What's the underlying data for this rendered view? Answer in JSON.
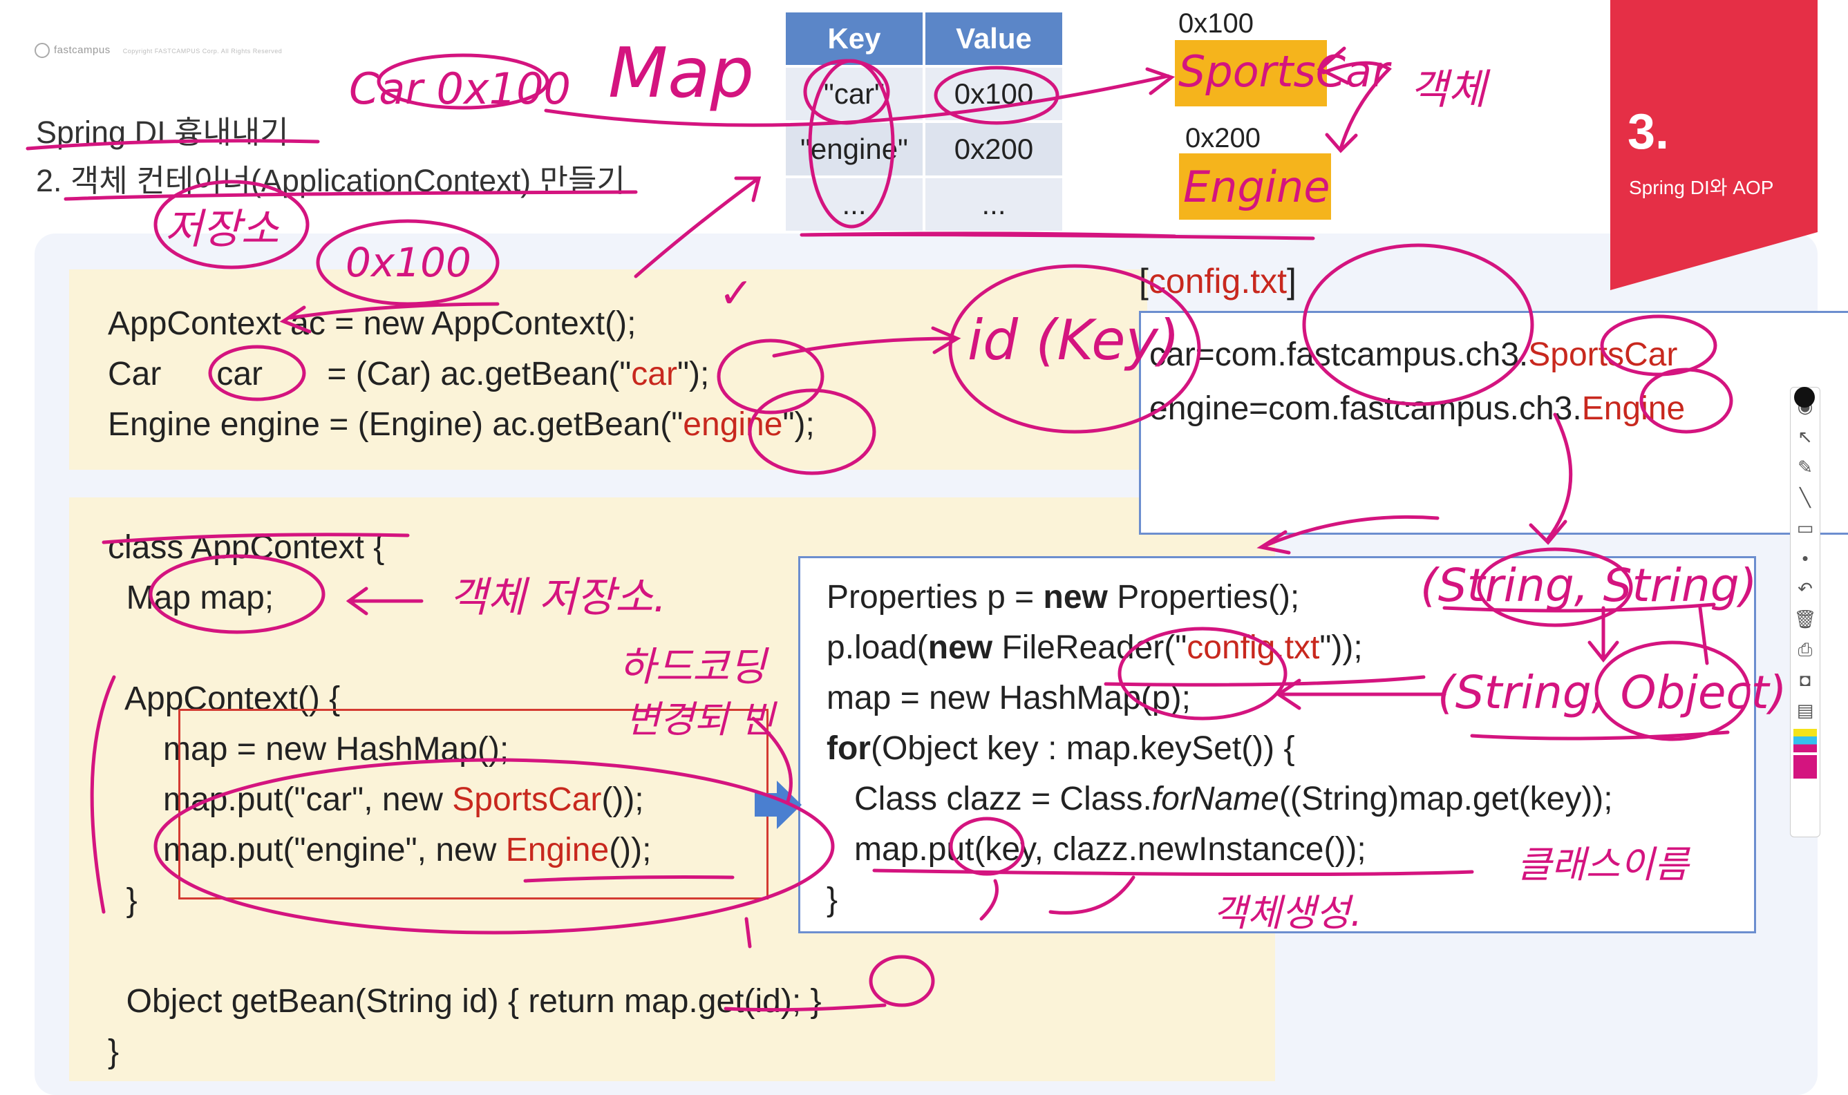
{
  "header": {
    "brand": "fastcampus",
    "copyright": "Copyright FASTCAMPUS Corp. All Rights Reserved",
    "title": "Spring DI 흉내내기",
    "subtitle": "2. 객체 컨테이너(ApplicationContext) 만들기"
  },
  "chapter": {
    "number": "3.",
    "name": "Spring DI와 AOP"
  },
  "map_table": {
    "headers": [
      "Key",
      "Value"
    ],
    "rows": [
      [
        "\"car\"",
        "0x100"
      ],
      [
        "\"engine\"",
        "0x200"
      ],
      [
        "...",
        "..."
      ]
    ]
  },
  "objects": [
    {
      "address": "0x100",
      "label": "SportsCar",
      "color": "#f5b41c"
    },
    {
      "address": "0x200",
      "label": "Engine",
      "color": "#f5b41c"
    }
  ],
  "code_usage": {
    "line1": "AppContext ac = new AppContext();",
    "line2_a": "Car      car       = (Car) ac.getBean(\"",
    "line2_str": "car",
    "line2_b": "\");",
    "line3_a": "Engine engine = (Engine) ac.getBean(\"",
    "line3_str": "engine",
    "line3_b": "\");"
  },
  "code_class": {
    "l1": "class AppContext {",
    "l2": "  Map map;",
    "l3": "",
    "l4": "  AppContext() {",
    "l5": "      map = new HashMap();",
    "l6_a": "      map.put(\"car\", new ",
    "l6_red": "SportsCar",
    "l6_b": "());",
    "l7_a": "      map.put(\"engine\", new ",
    "l7_red": "Engine",
    "l7_b": "());",
    "l8": "  }",
    "l9": "",
    "l10": "  Object getBean(String id) { return map.get(id); }",
    "l11": "}"
  },
  "properties_code": {
    "l1_a": "Properties p = ",
    "l1_kw": "new",
    "l1_b": " Properties();",
    "l2_a": "p.load(",
    "l2_kw": "new",
    "l2_b": " FileReader(\"",
    "l2_str": "config.txt",
    "l2_c": "\"));",
    "l3": "map = new HashMap(p);",
    "l4_kw": "for",
    "l4_b": "(Object key : map.keySet()) {",
    "l5_a": "   Class clazz = Class.",
    "l5_it": "forName",
    "l5_b": "((String)map.get(key));",
    "l6": "   map.put(key, clazz.newInstance());",
    "l7": "}"
  },
  "config": {
    "title_a": "[",
    "title_b": "config.txt",
    "title_c": "]",
    "l1_a": "car=com.fastcampus.ch3.",
    "l1_red": "SportsCar",
    "l2_a": "engine=com.fastcampus.ch3.",
    "l2_red": "Engine"
  },
  "annotations": {
    "car_addr": "Car 0x100",
    "map_word": "Map",
    "obj_word": "객체",
    "storage": "저장소",
    "addr": "0x100",
    "id_key": "id (Key)",
    "obj_storage": "객체 저장소.",
    "hardcoding": "하드코딩",
    "change": "변경되 빈",
    "string_string": "(String, String)",
    "string_object": "(String, Object)",
    "class_name": "클래스이름",
    "create_obj": "객체생성."
  },
  "toolbar": [
    "eye-icon",
    "pointer-icon",
    "pen-icon",
    "line-icon",
    "eraser-icon",
    "dot-icon",
    "undo-icon",
    "trash-icon",
    "print-icon",
    "camera-icon",
    "clipboard-icon"
  ],
  "colors": {
    "ink": "#d4147f",
    "banner": "#e52f46",
    "header_blue": "#5b86c8",
    "code_bg": "#fbf3d8",
    "object_fill": "#f5b41c"
  }
}
